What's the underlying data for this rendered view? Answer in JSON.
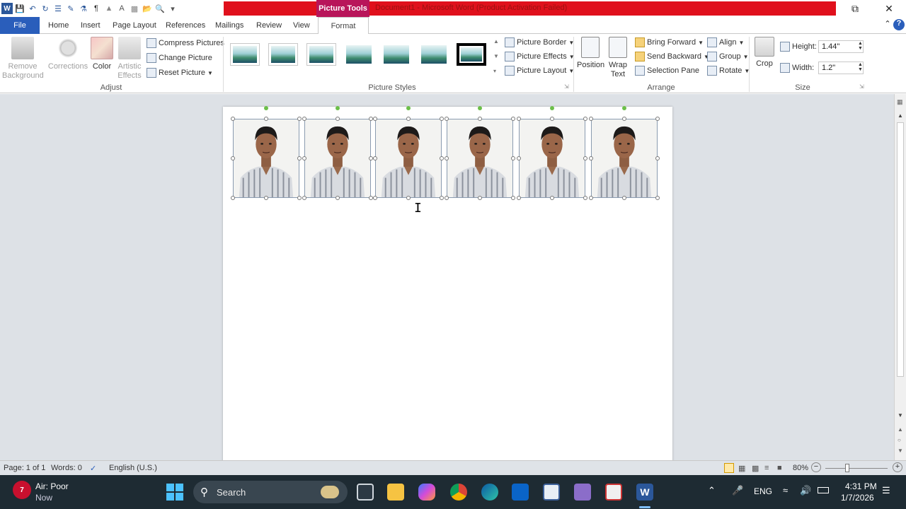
{
  "titlebar": {
    "context_tab_label": "Picture Tools",
    "document_title": "Document1 - Microsoft Word (Product Activation Failed)"
  },
  "tabs": {
    "file": "File",
    "items": [
      "Home",
      "Insert",
      "Page Layout",
      "References",
      "Mailings",
      "Review",
      "View"
    ],
    "active": "Format"
  },
  "ribbon": {
    "adjust": {
      "label": "Adjust",
      "remove_background": [
        "Remove",
        "Background"
      ],
      "corrections": "Corrections",
      "color": "Color",
      "artistic_effects": [
        "Artistic",
        "Effects"
      ],
      "compress_pictures": "Compress Pictures",
      "change_picture": "Change Picture",
      "reset_picture": "Reset Picture"
    },
    "picture_styles": {
      "label": "Picture Styles",
      "picture_border": "Picture Border",
      "picture_effects": "Picture Effects",
      "picture_layout": "Picture Layout"
    },
    "arrange": {
      "label": "Arrange",
      "position": "Position",
      "wrap_text": [
        "Wrap",
        "Text"
      ],
      "bring_forward": "Bring Forward",
      "send_backward": "Send Backward",
      "selection_pane": "Selection Pane",
      "align": "Align",
      "group": "Group",
      "rotate": "Rotate"
    },
    "size": {
      "label": "Size",
      "crop": "Crop",
      "height_label": "Height:",
      "height_value": "1.44\"",
      "width_label": "Width:",
      "width_value": "1.2\""
    }
  },
  "statusbar": {
    "page": "Page: 1 of 1",
    "words": "Words: 0",
    "language": "English (U.S.)",
    "zoom": "80%"
  },
  "taskbar": {
    "weather_badge": "7",
    "weather_title": "Air: Poor",
    "weather_sub": "Now",
    "search_placeholder": "Search",
    "lang": "ENG",
    "time": "4:31 PM",
    "date": "1/7/2026"
  },
  "colors": {
    "file_tab": "#2a5ebb",
    "context_tab": "#b8155a",
    "title_bar_red": "#e0101c",
    "taskbar": "#1e2b33"
  }
}
